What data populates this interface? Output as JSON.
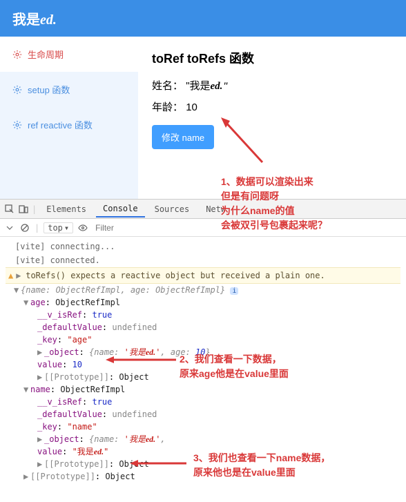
{
  "header": {
    "prefix": "我是",
    "suffix": "ed."
  },
  "sidebar": {
    "items": [
      {
        "label": "生命周期"
      },
      {
        "label": "setup 函数"
      },
      {
        "label": "ref reactive 函数"
      }
    ]
  },
  "main": {
    "title": "toRef toRefs 函数",
    "name_label": "姓名：",
    "name_value_prefix": "\"我是",
    "name_value_suffix": "ed.\"",
    "age_label": "年龄：",
    "age_value": "10",
    "button": "修改 name"
  },
  "annotations": {
    "a1": {
      "line1": "1、数据可以渲染出来",
      "line2": "但是有问题呀",
      "line3": "为什么name的值",
      "line4": "会被双引号包裹起来呢？"
    },
    "a2": {
      "line1": "2、我们查看一下数据，",
      "line2": "原来age他是在value里面"
    },
    "a3": {
      "line1": "3、我们也查看一下name数据，",
      "line2": "原来他也是在value里面"
    }
  },
  "devtools": {
    "tabs": [
      "Elements",
      "Console",
      "Sources",
      "Netw"
    ],
    "top": "top",
    "filter_placeholder": "Filter",
    "logs": [
      "[vite] connecting...",
      "[vite] connected."
    ],
    "warning": "toRefs() expects a reactive object but received a plain one.",
    "obj": {
      "root": "{name: ObjectRefImpl, age: ObjectRefImpl}",
      "age_type": "ObjectRefImpl",
      "name_type": "ObjectRefImpl",
      "isRef_k": "__v_isRef",
      "isRef_v": "true",
      "default_k": "_defaultValue",
      "default_v": "undefined",
      "key_k": "_key",
      "key_age": "\"age\"",
      "key_name": "\"name\"",
      "object_k": "_object",
      "object_preview": "{name: '我是ed.', age: 10}",
      "object_preview2": "{name: '我是ed.', ",
      "value_k": "value",
      "value_age": "10",
      "value_name": "\"我是ed.\"",
      "proto": "[[Prototype]]",
      "proto_v": "Object"
    }
  }
}
